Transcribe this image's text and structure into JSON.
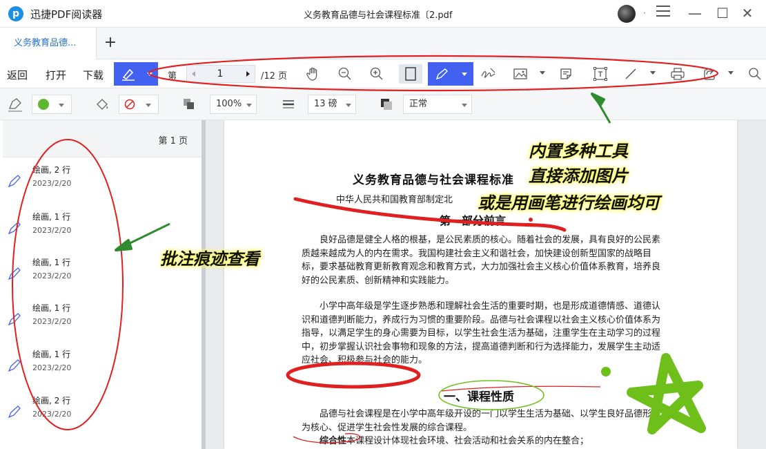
{
  "app": {
    "name": "迅捷PDF阅读器",
    "logo_glyph": "p",
    "doc_title": "义务教育品德与社会课程标准〔2.pdf"
  },
  "window": {
    "minimize": "—",
    "maximize": "☐",
    "close": "✕"
  },
  "tabs": {
    "active": "义务教育品德...",
    "add": "+"
  },
  "toolbar": {
    "back": "返回",
    "open": "打开",
    "download": "下载",
    "page_prefix": "第",
    "current_page": "1",
    "total": "/12 页",
    "accent_color": "#4361f0"
  },
  "format": {
    "opacity": "100%",
    "line_width": "13 磅",
    "blend": "正常",
    "fill_color": "#5cb82e"
  },
  "sidebar": {
    "page_label": "第 1 页",
    "items": [
      {
        "title": "绘画, 2 行",
        "date": "2023/2/20"
      },
      {
        "title": "绘画, 1 行",
        "date": "2023/2/20"
      },
      {
        "title": "绘画, 1 行",
        "date": "2023/2/20"
      },
      {
        "title": "绘画, 1 行",
        "date": "2023/2/20"
      },
      {
        "title": "绘画, 1 行",
        "date": "2023/2/20"
      },
      {
        "title": "绘画, 2 行",
        "date": "2023/2/20"
      }
    ]
  },
  "document": {
    "title": "义务教育品德与社会课程标准",
    "subtitle": "中华人民共和国教育部制定北",
    "part": "第一部分前言",
    "p1": "良好品德是健全人格的根基，是公民素质的核心。随着社会的发展，具有良好的公民素质越来越成为人的内在需求。我国构建社会主义和谐社会，加快建设创新型国家的战略目标，要求基础教育更新教育观念和教育方式，大力加强社会主义核心价值体系教育，培养良好的公民素质、创新精神和实践能力。",
    "p2": "小学中高年级是学生逐步熟悉和理解社会生活的重要时期，也是形成道德情感、道德认识和道德判断能力，养成行为习惯的重要阶段。品德与社会课程以社会主义核心价值体系为指导，以满足学生的身心需要为目标，以学生社会生活为基础，注重学生在主动学习的过程中，初步掌握认识社会事物和现象的方法，提高道德判断和行为选择能力，发展学生主动适应社会、积极参与社会的能力。",
    "section": "一、课程性质",
    "p3": "品德与社会课程是在小学中高年级开设的一门以学生生活为基础、以学生良好品德形成为核心、促进学生社会性发展的综合课程。",
    "p4_bold": "综合性",
    "p4": "本课程设计体现社会环境、社会活动和社会关系的内在整合；"
  },
  "callouts": {
    "right_1": "内置多种工具",
    "right_2": "直接添加图片",
    "right_3": "或是用画笔进行绘画均可",
    "left": "批注痕迹查看"
  },
  "annotation_colors": {
    "red": "#e02020",
    "green": "#6fbf1a",
    "arrow_green": "#2e8b2e"
  }
}
